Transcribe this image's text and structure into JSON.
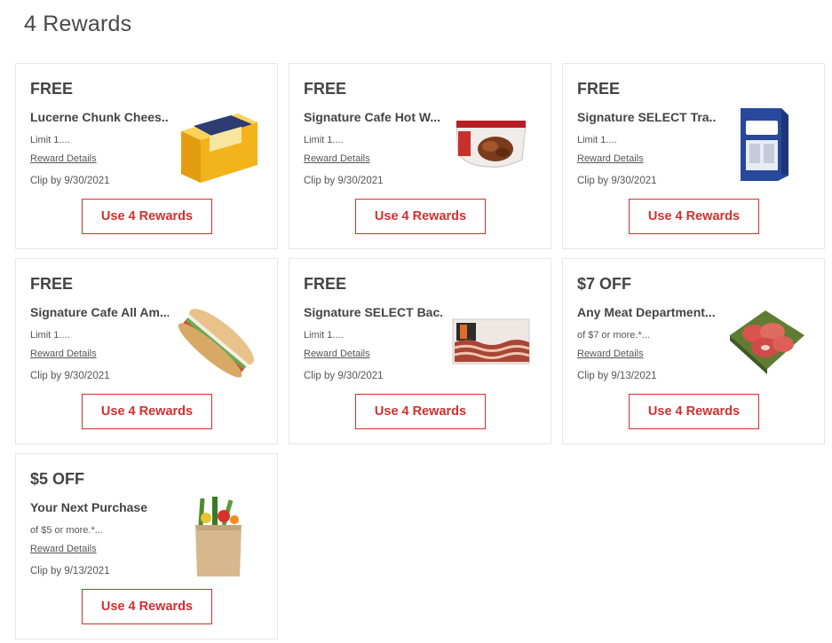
{
  "page": {
    "title": "4 Rewards"
  },
  "button_label": "Use 4 Rewards",
  "details_label": "Reward Details",
  "cards": [
    {
      "offer": "FREE",
      "name": "Lucerne Chunk Chees...",
      "desc": "Limit 1....",
      "clip": "Clip by 9/30/2021",
      "icon": "cheese-icon"
    },
    {
      "offer": "FREE",
      "name": "Signature Cafe Hot W...",
      "desc": "Limit 1....",
      "clip": "Clip by 9/30/2021",
      "icon": "chicken-wings-icon"
    },
    {
      "offer": "FREE",
      "name": "Signature SELECT Tra...",
      "desc": "Limit 1....",
      "clip": "Clip by 9/30/2021",
      "icon": "trash-bags-icon"
    },
    {
      "offer": "FREE",
      "name": "Signature Cafe All Am...",
      "desc": "Limit 1....",
      "clip": "Clip by 9/30/2021",
      "icon": "sandwich-icon"
    },
    {
      "offer": "FREE",
      "name": "Signature SELECT Bac...",
      "desc": "Limit 1....",
      "clip": "Clip by 9/30/2021",
      "icon": "bacon-icon"
    },
    {
      "offer": "$7 OFF",
      "name": "Any Meat Department...",
      "desc": "of $7 or more.*...",
      "clip": "Clip by 9/13/2021",
      "icon": "meat-icon"
    },
    {
      "offer": "$5 OFF",
      "name": "Your Next Purchase",
      "desc": "of $5 or more.*...",
      "clip": "Clip by 9/13/2021",
      "icon": "grocery-bag-icon"
    }
  ]
}
